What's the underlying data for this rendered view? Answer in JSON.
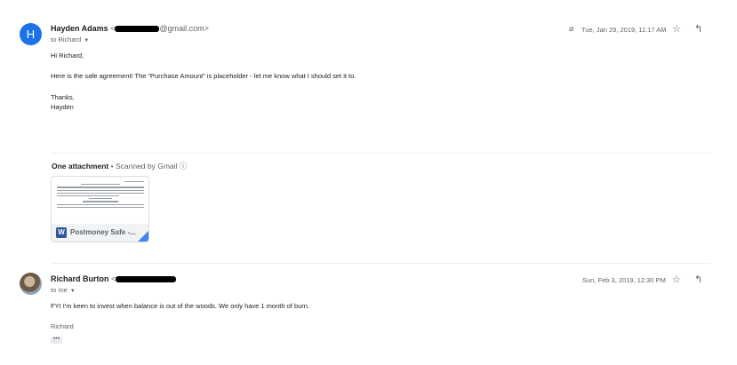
{
  "message1": {
    "avatar_letter": "H",
    "sender_name": "Hayden Adams",
    "email_prefix": "<",
    "email_suffix": "@gmail.com>",
    "to_line": "to Richard",
    "date": "Tue, Jan 29, 2019, 11:17 AM",
    "body": [
      "Hi Richard,",
      "Here is the safe agreement! The “Purchase Amount” is placeholder - let me know what I should set it to.",
      "Thanks,",
      "Hayden"
    ],
    "attachments_header": "One attachment",
    "scanned_text": "•  Scanned by Gmail ⓘ",
    "attachment": {
      "file_type_letter": "W",
      "file_name": "Postmoney Safe -..."
    }
  },
  "message2": {
    "sender_name": "Richard Burton",
    "email_prefix": "<",
    "to_line": "to me",
    "date": "Sun, Feb 3, 2019, 12:30 PM",
    "body": [
      "FYI I'm keen to invest when balance is out of the woods. We only have 1 month of burn.",
      "Richard"
    ],
    "ellipsis": "•••"
  },
  "icons": {
    "star": "☆",
    "reply": "↰",
    "paperclip": "⌀",
    "caret": "▼"
  }
}
